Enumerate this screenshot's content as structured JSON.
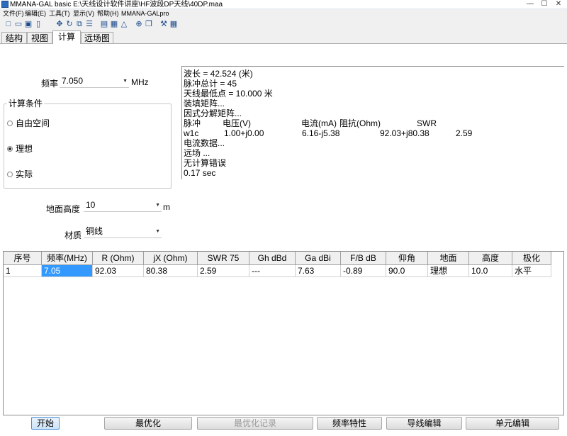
{
  "window": {
    "title": "MMANA-GAL basic  E:\\天线设计软件讲座\\HF波段DP天线\\40DP.maa"
  },
  "menu": [
    "文件(F)",
    "编辑(E)",
    "工具(T)",
    "显示(V)",
    "帮助(H)",
    "MMANA-GALpro"
  ],
  "tabs": [
    "结构",
    "视图",
    "计算",
    "远场图"
  ],
  "freq": {
    "label": "频率",
    "value": "7.050",
    "unit": "MHz"
  },
  "conditions": {
    "title": "计算条件",
    "options": [
      "自由空间",
      "理想",
      "实际"
    ],
    "selected": "理想"
  },
  "ground": {
    "label": "地面高度",
    "value": "10",
    "unit": "m"
  },
  "material": {
    "label": "材质",
    "value": "铜线"
  },
  "results": {
    "wavelength": "波长 = 42.524 (米)",
    "pulses": "脉冲总计 = 45",
    "lowest": "天线最低点 = 10.000 米",
    "fill_matrix": "装填矩阵...",
    "factor_matrix": "因式分解矩阵...",
    "header": {
      "pulse": "脉冲",
      "voltage": "电压(V)",
      "current": "电流(mA)",
      "impedance": "阻抗(Ohm)",
      "swr": "SWR"
    },
    "row": {
      "pulse": "w1c",
      "voltage": "1.00+j0.00",
      "current": "6.16-j5.38",
      "impedance": "92.03+j80.38",
      "swr": "2.59"
    },
    "current_data": "电流数据...",
    "far_field": "远场 ...",
    "no_error": "无计算错误",
    "time": "0.17 sec"
  },
  "table": {
    "headers": [
      "序号",
      "频率(MHz)",
      "R (Ohm)",
      "jX (Ohm)",
      "SWR 75",
      "Gh dBd",
      "Ga dBi",
      "F/B dB",
      "仰角",
      "地面",
      "高度",
      "极化"
    ],
    "rows": [
      [
        "1",
        "7.05",
        "92.03",
        "80.38",
        "2.59",
        "---",
        "7.63",
        "-0.89",
        "90.0",
        "理想",
        "10.0",
        "水平"
      ]
    ]
  },
  "buttons": {
    "start": "开始",
    "optimize": "最优化",
    "opt_log": "最优化记录",
    "freq_char": "频率特性",
    "wire_edit": "导线编辑",
    "elem_edit": "单元编辑"
  },
  "icons": [
    "new-icon",
    "open-icon",
    "save-icon",
    "info-icon",
    "move-icon",
    "rotate-icon",
    "copy-icon",
    "list-icon",
    "doc-icon",
    "table-icon",
    "delta-icon",
    "target-icon",
    "duplicate-icon",
    "tools-icon",
    "calc-icon"
  ]
}
